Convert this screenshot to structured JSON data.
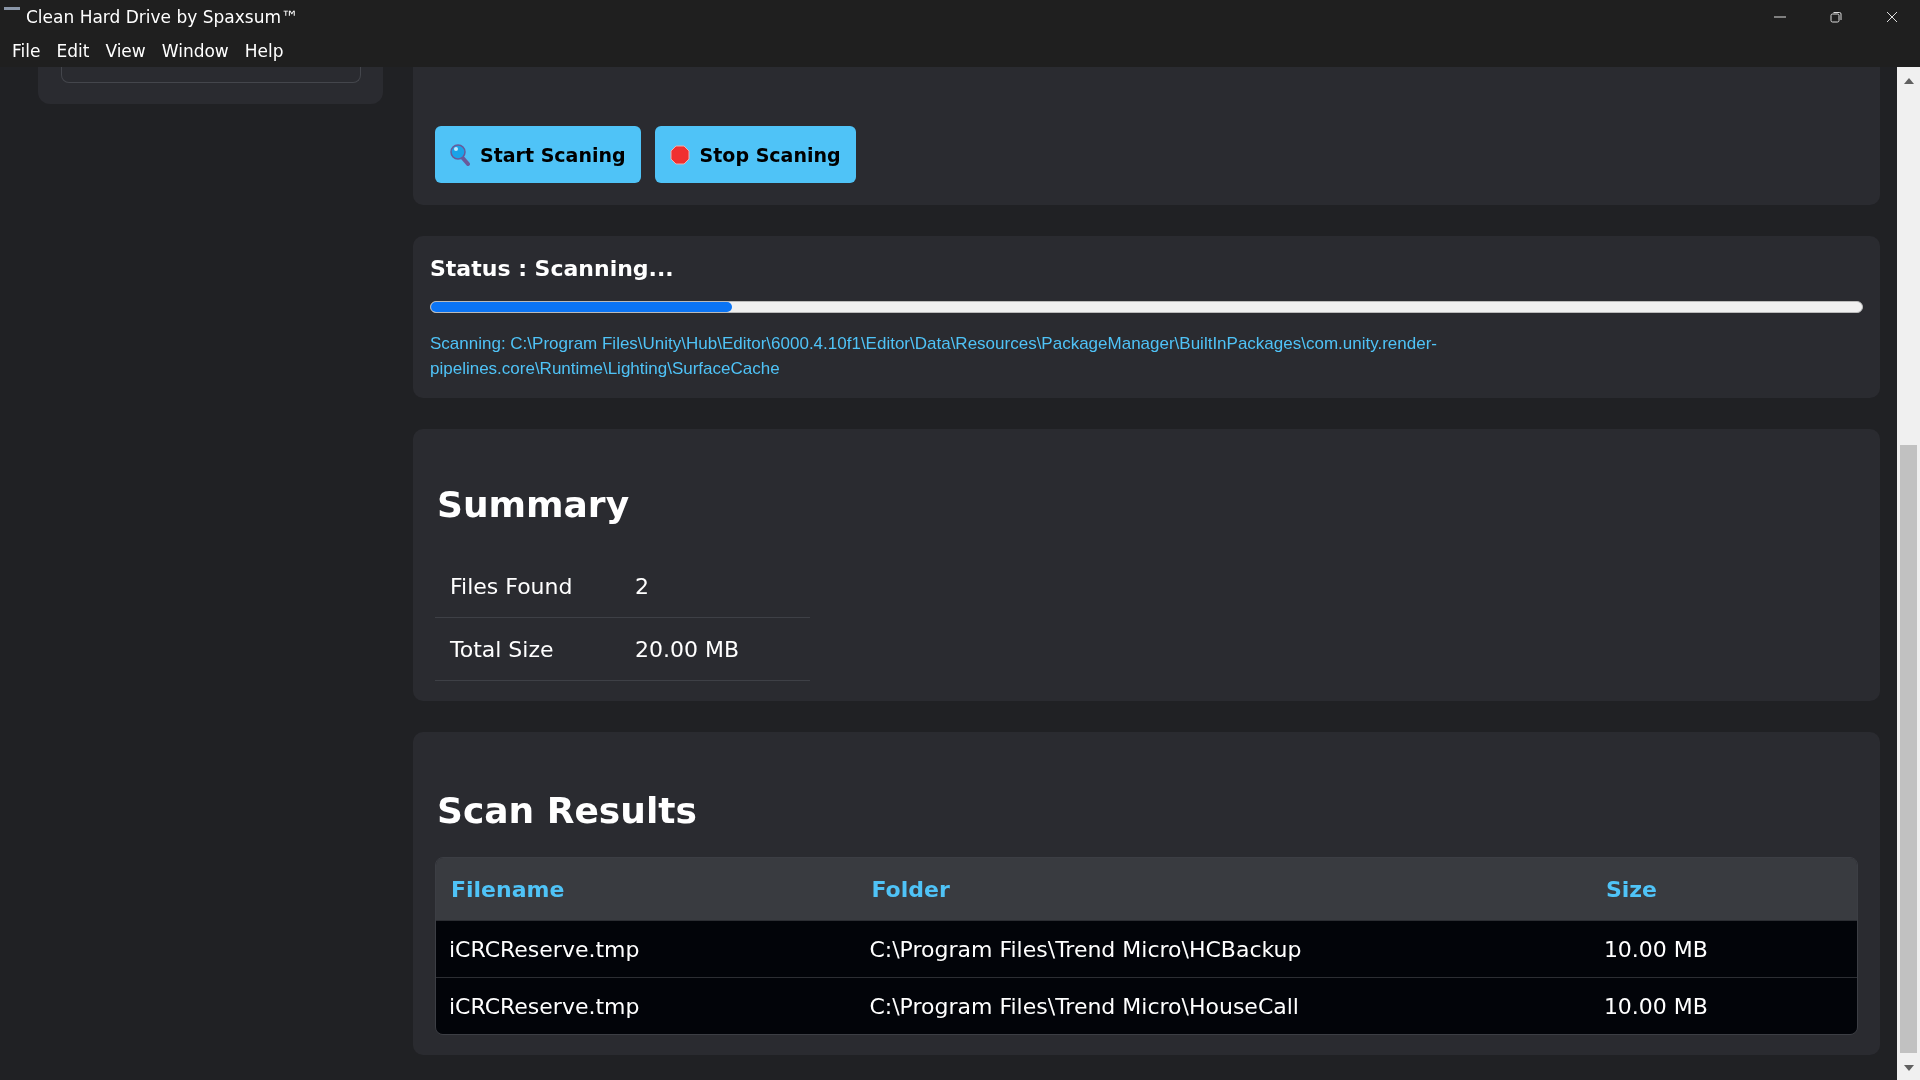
{
  "window": {
    "title": "Clean Hard Drive by Spaxsum™"
  },
  "menu": [
    "File",
    "Edit",
    "View",
    "Window",
    "Help"
  ],
  "actions": [
    {
      "label": "Start Scaning",
      "kind": "start"
    },
    {
      "label": "Stop Scaning",
      "kind": "stop"
    }
  ],
  "status": {
    "title": "Status : Scanning...",
    "progress": {
      "level": 0.21
    },
    "path": "Scanning: C:\\Program Files\\Unity\\Hub\\Editor\\6000.4.10f1\\Editor\\Data\\Resources\\PackageManager\\BuiltInPackages\\com.unity.render-pipelines.core\\Runtime\\Lighting\\SurfaceCache"
  },
  "summary": {
    "title": "Summary",
    "rows": [
      {
        "label": "Files Found",
        "value": "2"
      },
      {
        "label": "Total Size",
        "value": "20.00 MB"
      }
    ]
  },
  "results": {
    "title": "Scan Results",
    "columns": [
      "Filename",
      "Folder",
      "Size"
    ],
    "rows": [
      [
        "iCRCReserve.tmp",
        "C:\\Program Files\\Trend Micro\\HCBackup",
        "10.00 MB"
      ],
      [
        "iCRCReserve.tmp",
        "C:\\Program Files\\Trend Micro\\HouseCall",
        "10.00 MB"
      ]
    ]
  }
}
